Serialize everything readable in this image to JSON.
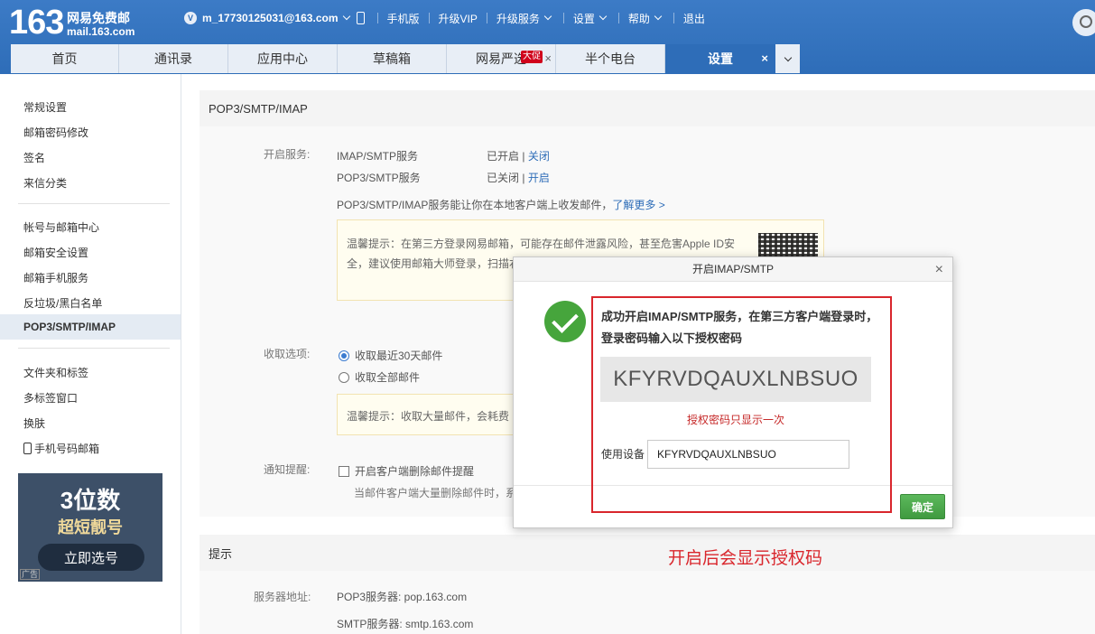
{
  "header": {
    "logo_number": "163",
    "logo_text": "网易免费邮",
    "logo_domain": "mail.163.com",
    "vip_badge": "V",
    "account": "m_17730125031@163.com",
    "nav": [
      "手机版",
      "升级VIP",
      "升级服务",
      "设置",
      "帮助",
      "退出"
    ]
  },
  "tabs": [
    {
      "label": "首页"
    },
    {
      "label": "通讯录"
    },
    {
      "label": "应用中心"
    },
    {
      "label": "草稿箱"
    },
    {
      "label": "网易严选",
      "badge": "大促",
      "close": "×"
    },
    {
      "label": "半个电台"
    },
    {
      "label": "设置",
      "close": "×"
    }
  ],
  "sidebar": {
    "group1": [
      "常规设置",
      "邮箱密码修改",
      "签名",
      "来信分类"
    ],
    "group2": [
      "帐号与邮箱中心",
      "邮箱安全设置",
      "邮箱手机服务",
      "反垃圾/黑白名单",
      "POP3/SMTP/IMAP"
    ],
    "group3": [
      "文件夹和标签",
      "多标签窗口",
      "换肤",
      "手机号码邮箱"
    ],
    "selected": "POP3/SMTP/IMAP",
    "ad": {
      "line1": "3位数",
      "line2": "超短靓号",
      "button": "立即选号",
      "tag": "广告"
    }
  },
  "main": {
    "section_title": "POP3/SMTP/IMAP",
    "enable_label": "开启服务:",
    "services": [
      {
        "name": "IMAP/SMTP服务",
        "status": "已开启",
        "sep": "|",
        "action": "关闭"
      },
      {
        "name": "POP3/SMTP服务",
        "status": "已关闭",
        "sep": "|",
        "action": "开启"
      }
    ],
    "service_desc": "POP3/SMTP/IMAP服务能让你在本地客户端上收发邮件，",
    "learn_more": "了解更多 >",
    "tip1_line1": "温馨提示：在第三方登录网易邮箱，可能存在邮件泄露风险，甚至危害Apple ID安",
    "tip1_line2": "全，建议使用邮箱大师登录，扫描右侧二维码",
    "receive_label": "收取选项:",
    "receive_opt1": "收取最近30天邮件",
    "receive_opt2": "收取全部邮件",
    "tip2": "温馨提示：收取大量邮件，会耗费",
    "notify_label": "通知提醒:",
    "notify_opt": "开启客户端删除邮件提醒",
    "notify_desc": "当邮件客户端大量删除邮件时，系",
    "hint_title": "提示",
    "server_label": "服务器地址:",
    "pop3_server": "POP3服务器: pop.163.com",
    "smtp_server": "SMTP服务器: smtp.163.com"
  },
  "dialog": {
    "title": "开启IMAP/SMTP",
    "close": "×",
    "message": "成功开启IMAP/SMTP服务，在第三方客户端登录时，登录密码输入以下授权密码",
    "auth_code": "KFYRVDQAUXLNBSUO",
    "note": "授权密码只显示一次",
    "device_label": "使用设备",
    "device_value": "KFYRVDQAUXLNBSUO",
    "ok_label": "确定"
  },
  "annotation": "开启后会显示授权码",
  "colors": {
    "brand": "#2e6db8",
    "success": "#46a53c",
    "annotation_red": "#d9262c"
  }
}
